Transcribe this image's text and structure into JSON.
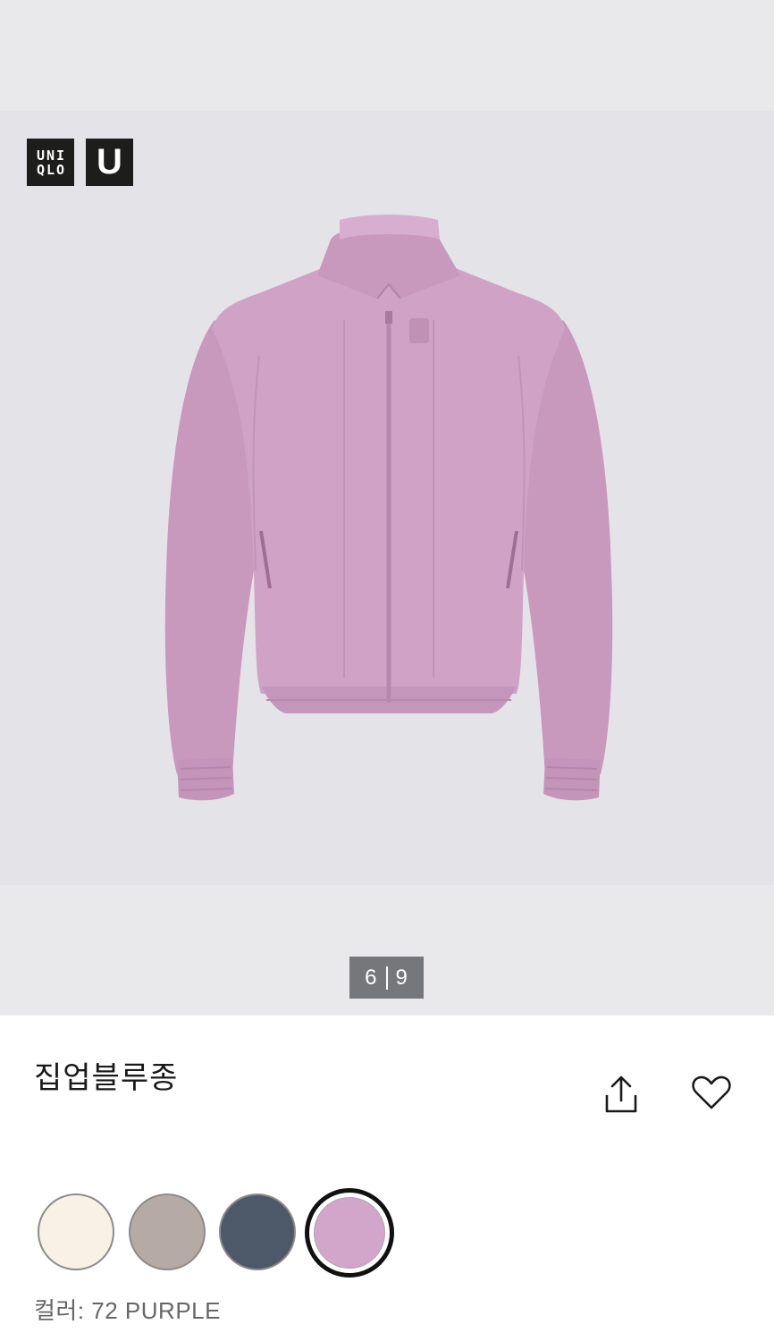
{
  "gallery": {
    "counter_current": "6",
    "counter_total": "9"
  },
  "brand": {
    "logo_text_line1": "UNI",
    "logo_text_line2": "QLO",
    "logo_u": "U"
  },
  "product": {
    "title": "집업블루종",
    "color_label": "컬러: 72 PURPLE"
  },
  "actions": {
    "share_icon": "share-icon",
    "favorite_icon": "heart-icon"
  },
  "colors": {
    "swatches": [
      "#f8f2e6",
      "#b5aba4",
      "#4d5868",
      "#d2a6cb"
    ],
    "selected_index": 3,
    "jacket_main": "#d0a3c6",
    "jacket_shadow": "#b684ab",
    "jacket_light": "#dcb3d2"
  }
}
